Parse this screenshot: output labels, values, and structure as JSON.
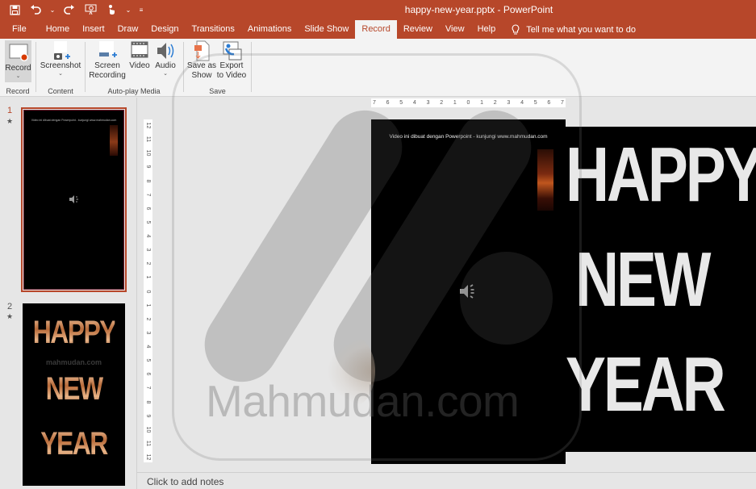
{
  "app": {
    "document_title": "happy-new-year.pptx  -  PowerPoint"
  },
  "quick_access": {
    "items": [
      "save-icon",
      "undo-icon",
      "undo-dropdown",
      "redo-icon",
      "present-icon",
      "touch-mode-icon",
      "touch-dropdown",
      "customize-qat-icon"
    ]
  },
  "tabs": [
    {
      "label": "File"
    },
    {
      "label": "Home"
    },
    {
      "label": "Insert"
    },
    {
      "label": "Draw"
    },
    {
      "label": "Design"
    },
    {
      "label": "Transitions"
    },
    {
      "label": "Animations"
    },
    {
      "label": "Slide Show"
    },
    {
      "label": "Record",
      "active": true
    },
    {
      "label": "Review"
    },
    {
      "label": "View"
    },
    {
      "label": "Help"
    }
  ],
  "tell_me": "Tell me what you want to do",
  "ribbon": {
    "groups": {
      "record": {
        "label": "Record",
        "buttons": {
          "record": "Record"
        }
      },
      "content": {
        "label": "Content",
        "buttons": {
          "screenshot": "Screenshot"
        }
      },
      "autoplay": {
        "label": "Auto-play Media",
        "buttons": {
          "screen_recording_1": "Screen",
          "screen_recording_2": "Recording",
          "video": "Video",
          "audio": "Audio"
        }
      },
      "save": {
        "label": "Save",
        "buttons": {
          "save_as_show_1": "Save as",
          "save_as_show_2": "Show",
          "export_1": "Export",
          "export_2": "to Video"
        }
      }
    }
  },
  "slides": [
    {
      "number": "1",
      "caption": "Video ini dibuat dengan Powerpoint - kunjungi www.mahmudan.com",
      "selected": true
    },
    {
      "number": "2",
      "lines": [
        "HAPPY",
        "NEW",
        "YEAR"
      ],
      "site": "mahmudan.com"
    }
  ],
  "rulers": {
    "horizontal": [
      "7",
      "6",
      "5",
      "4",
      "3",
      "2",
      "1",
      "0",
      "1",
      "2",
      "3",
      "4",
      "5",
      "6",
      "7"
    ],
    "vertical": [
      "12",
      "11",
      "10",
      "9",
      "8",
      "7",
      "6",
      "5",
      "4",
      "3",
      "2",
      "1",
      "0",
      "1",
      "2",
      "3",
      "4",
      "5",
      "6",
      "7",
      "8",
      "9",
      "10",
      "11",
      "12"
    ]
  },
  "editor": {
    "caption": "Video ini dibuat dengan Powerpoint - kunjungi www.mahmudan.com",
    "overflow_words": [
      "HAPPY",
      "NEW",
      "YEAR"
    ]
  },
  "notes_placeholder": "Click to add notes",
  "watermark": "Mahmudan.com",
  "colors": {
    "accent": "#b7472a",
    "ribbon_bg": "#f3f3f3",
    "workspace_bg": "#e6e6e6"
  }
}
